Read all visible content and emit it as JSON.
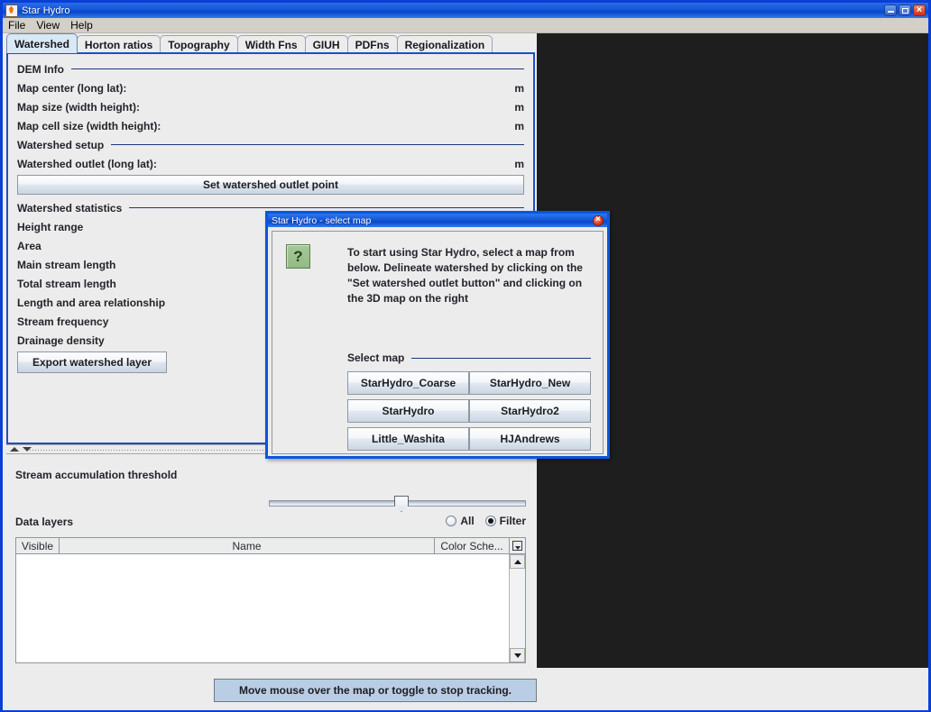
{
  "window": {
    "title": "Star Hydro",
    "icon": "app-icon",
    "controls": [
      {
        "name": "minimize",
        "glyph": "minimize-icon"
      },
      {
        "name": "maximize",
        "glyph": "maximize-icon"
      },
      {
        "name": "close",
        "glyph": "close-icon"
      }
    ]
  },
  "menubar": {
    "items": [
      {
        "label": "File"
      },
      {
        "label": "View"
      },
      {
        "label": "Help"
      }
    ]
  },
  "tabs": [
    {
      "label": "Watershed",
      "active": true
    },
    {
      "label": "Horton ratios",
      "active": false
    },
    {
      "label": "Topography",
      "active": false
    },
    {
      "label": "Width Fns",
      "active": false
    },
    {
      "label": "GIUH",
      "active": false
    },
    {
      "label": "PDFns",
      "active": false
    },
    {
      "label": "Regionalization",
      "active": false
    }
  ],
  "watershed_panel": {
    "dem_info": {
      "section_title": "DEM Info",
      "fields": [
        {
          "label": "Map center (long lat):",
          "value": "",
          "unit": "m"
        },
        {
          "label": "Map size (width height):",
          "value": "",
          "unit": "m"
        },
        {
          "label": "Map cell size (width height):",
          "value": "",
          "unit": "m"
        }
      ]
    },
    "watershed_setup": {
      "section_title": "Watershed setup",
      "outlet_label": "Watershed outlet (long lat):",
      "outlet_value": "",
      "outlet_unit": "m",
      "set_outlet_button": "Set watershed outlet point"
    },
    "watershed_statistics": {
      "section_title": "Watershed statistics",
      "stats": [
        {
          "label": "Height range",
          "value": ""
        },
        {
          "label": "Area",
          "value": ""
        },
        {
          "label": "Main stream length",
          "value": ""
        },
        {
          "label": "Total stream length",
          "value": ""
        },
        {
          "label": "Length and area relationship",
          "value": ""
        },
        {
          "label": "Stream frequency",
          "value": ""
        },
        {
          "label": "Drainage density",
          "value": ""
        }
      ],
      "export_button": "Export watershed layer"
    }
  },
  "lower_panel": {
    "threshold_label": "Stream accumulation threshold",
    "slider": {
      "position_percent": 49
    },
    "data_layers_label": "Data layers",
    "filter_radios": [
      {
        "label": "All",
        "selected": false
      },
      {
        "label": "Filter",
        "selected": true
      }
    ],
    "table": {
      "columns": [
        "Visible",
        "Name",
        "Color Sche..."
      ],
      "rows": []
    }
  },
  "statusbar": {
    "message": "Move mouse over the map or toggle to stop tracking."
  },
  "dialog": {
    "title": "Star Hydro - select map",
    "close_glyph": "close-icon",
    "help_glyph": "?",
    "body_text": "To start using Star Hydro, select a map from below.\nDelineate watershed by clicking on the \"Set watershed outlet button\" and clicking on the 3D map on the right",
    "section_title": "Select map",
    "map_buttons": [
      {
        "label": "StarHydro_Coarse"
      },
      {
        "label": "StarHydro_New"
      },
      {
        "label": "StarHydro"
      },
      {
        "label": "StarHydro2"
      },
      {
        "label": "Little_Washita"
      },
      {
        "label": "HJAndrews"
      }
    ]
  },
  "colors": {
    "window_border": "#0a3fd6",
    "titlebar": "#1356d8",
    "panel_bg": "#ececec",
    "menubar_bg": "#d4d0c8",
    "map_bg": "#1e1e1e",
    "active_tab": "#d8e8f4",
    "separator": "#1b3a7a",
    "status_button": "#b9cde4",
    "help_icon": "#93ba84"
  }
}
